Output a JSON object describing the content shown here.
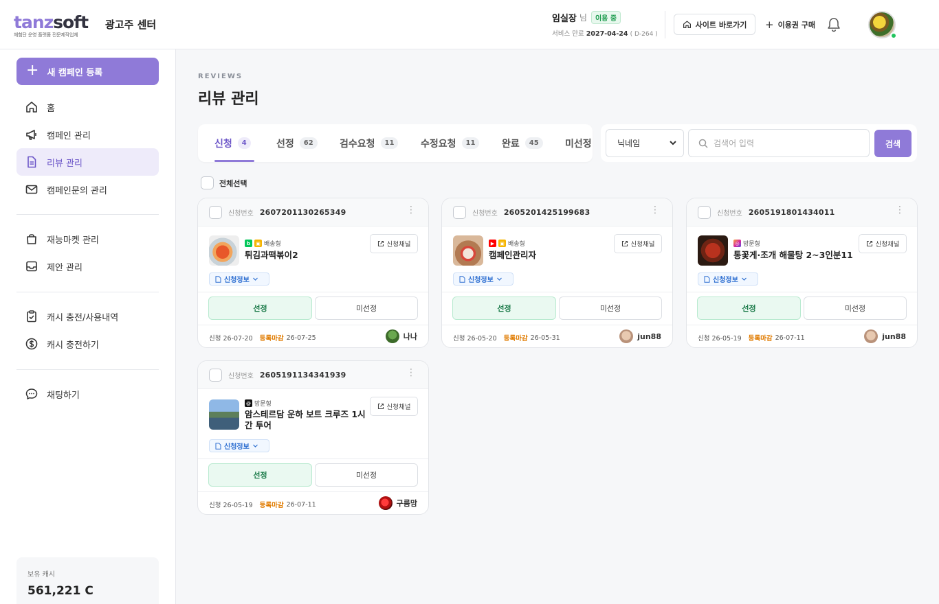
{
  "header": {
    "logo_part1": "tanz",
    "logo_part2": "soft",
    "logo_sub": "체험단 운영 플랫폼 전문제작업체",
    "center_name": "광고주 센터",
    "user_name": "임실장",
    "user_honorific": "님",
    "status_badge": "이용 중",
    "expiry_label": "서비스 만료",
    "expiry_date": "2027-04-24",
    "expiry_dday": "( D-264 )",
    "site_button": "사이트 바로가기",
    "buy_button": "이용권 구매"
  },
  "sidebar": {
    "new_campaign": "새 캠페인 등록",
    "items": [
      {
        "label": "홈"
      },
      {
        "label": "캠페인 관리"
      },
      {
        "label": "리뷰 관리"
      },
      {
        "label": "캠페인문의 관리"
      },
      {
        "label": "재능마켓 관리"
      },
      {
        "label": "제안 관리"
      },
      {
        "label": "캐시 충전/사용내역"
      },
      {
        "label": "캐시 충전하기"
      },
      {
        "label": "채팅하기"
      }
    ],
    "cash_label": "보유 캐시",
    "cash_value": "561,221 C"
  },
  "main": {
    "eyebrow": "REVIEWS",
    "title": "리뷰 관리",
    "tabs": [
      {
        "label": "신청",
        "count": "4"
      },
      {
        "label": "선정",
        "count": "62"
      },
      {
        "label": "검수요청",
        "count": "11"
      },
      {
        "label": "수정요청",
        "count": "11"
      },
      {
        "label": "완료",
        "count": "45"
      },
      {
        "label": "미선정",
        "count": ""
      }
    ],
    "search_select": "닉네임",
    "search_placeholder": "검색어 입력",
    "search_button": "검색",
    "select_all": "전체선택"
  },
  "cards": [
    {
      "app_label": "신청번호",
      "app_no": "2607201130265349",
      "type": "배송형",
      "title": "튀김과떡볶이2",
      "channel_btn": "신청채널",
      "info_btn": "신청정보",
      "select_btn": "선정",
      "unselect_btn": "미선정",
      "apply_text": "신청 26-07-20",
      "deadline_label": "등록마감",
      "deadline_date": "26-07-25",
      "user": "나나"
    },
    {
      "app_label": "신청번호",
      "app_no": "2605201425199683",
      "type": "배송형",
      "title": "캠페인관리자",
      "channel_btn": "신청채널",
      "info_btn": "신청정보",
      "select_btn": "선정",
      "unselect_btn": "미선정",
      "apply_text": "신청 26-05-20",
      "deadline_label": "등록마감",
      "deadline_date": "26-05-31",
      "user": "jun88"
    },
    {
      "app_label": "신청번호",
      "app_no": "2605191801434011",
      "type": "방문형",
      "title": "통꽃게·조개 해물탕 2~3인분11",
      "channel_btn": "신청채널",
      "info_btn": "신청정보",
      "select_btn": "선정",
      "unselect_btn": "미선정",
      "apply_text": "신청 26-05-19",
      "deadline_label": "등록마감",
      "deadline_date": "26-07-11",
      "user": "jun88"
    },
    {
      "app_label": "신청번호",
      "app_no": "2605191134341939",
      "type": "방문형",
      "title": "암스테르담 운하 보트 크루즈 1시간 투어",
      "channel_btn": "신청채널",
      "info_btn": "신청정보",
      "select_btn": "선정",
      "unselect_btn": "미선정",
      "apply_text": "신청 26-05-19",
      "deadline_label": "등록마감",
      "deadline_date": "26-07-11",
      "user": "구름맘"
    }
  ],
  "colors": {
    "accent": "#8f7ad8",
    "select_green": "#eaf9f1",
    "deadline_orange": "#e07b00"
  }
}
